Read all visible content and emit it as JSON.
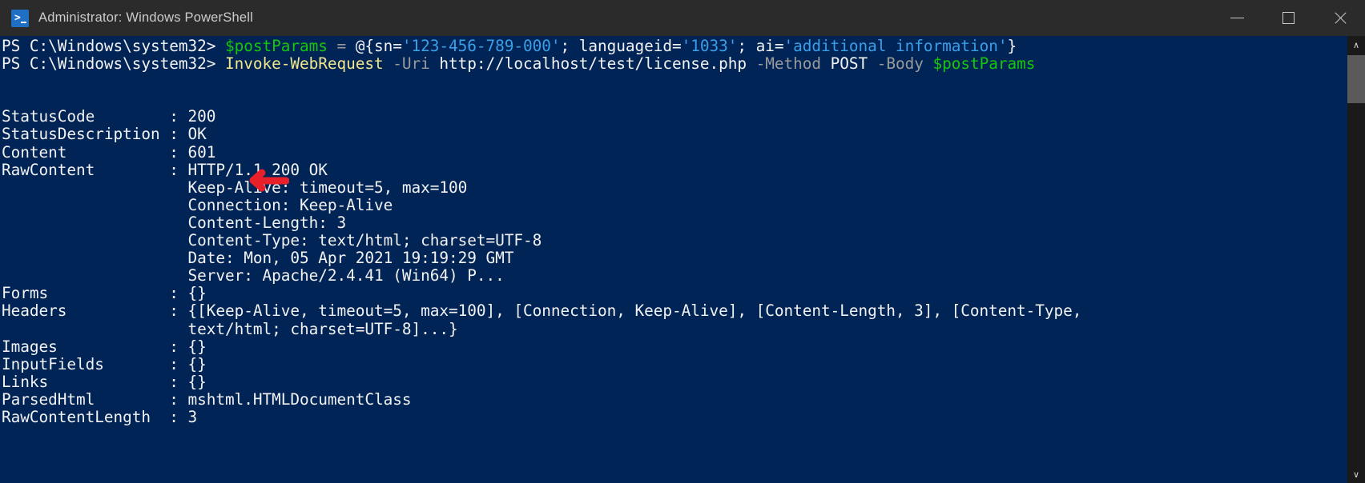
{
  "window": {
    "title": "Administrator: Windows PowerShell",
    "app_icon": "powershell-prompt-icon",
    "controls": {
      "minimize_label": "Minimize",
      "maximize_label": "Maximize",
      "close_label": "Close"
    }
  },
  "colors": {
    "titlebar_bg": "#2b2b2b",
    "console_bg": "#012456",
    "text": "#f2f2f2",
    "variable_green": "#16c60c",
    "string_cyan": "#3b9fe8",
    "parameter_gray": "#9a9a9a",
    "command_yellow": "#f0e68c",
    "annotation_red": "#e8202a",
    "scrollbar_track": "#1a1a1a",
    "scrollbar_thumb": "#5a5a5a"
  },
  "console": {
    "prompt": "PS C:\\Windows\\system32>",
    "command_1": {
      "variable": "$postParams",
      "equals": " = ",
      "hash_open": "@{sn=",
      "sn_value": "'123-456-789-000'",
      "sep_1": "; languageid=",
      "languageid_value": "'1033'",
      "sep_2": "; ai=",
      "ai_value": "'additional information'",
      "hash_close": "}"
    },
    "command_2": {
      "cmdlet": "Invoke-WebRequest",
      "param_uri": "-Uri",
      "uri_value": "http://localhost/test/license.php",
      "param_method": "-Method",
      "method_value": "POST",
      "param_body": "-Body",
      "body_value": "$postParams"
    },
    "output": {
      "rows": [
        {
          "key": "StatusCode",
          "sep": ":",
          "value": "200"
        },
        {
          "key": "StatusDescription",
          "sep": ":",
          "value": "OK"
        },
        {
          "key": "Content",
          "sep": ":",
          "value": "601"
        },
        {
          "key": "RawContent",
          "sep": ":",
          "value": "HTTP/1.1 200 OK"
        }
      ],
      "rawcontent_continuation": [
        "Keep-Alive: timeout=5, max=100",
        "Connection: Keep-Alive",
        "Content-Length: 3",
        "Content-Type: text/html; charset=UTF-8",
        "Date: Mon, 05 Apr 2021 19:19:29 GMT",
        "Server: Apache/2.4.41 (Win64) P..."
      ],
      "rows_2": [
        {
          "key": "Forms",
          "sep": ":",
          "value": "{}"
        },
        {
          "key": "Headers",
          "sep": ":",
          "value": "{[Keep-Alive, timeout=5, max=100], [Connection, Keep-Alive], [Content-Length, 3], [Content-Type,"
        }
      ],
      "headers_continuation": "text/html; charset=UTF-8]...}",
      "rows_3": [
        {
          "key": "Images",
          "sep": ":",
          "value": "{}"
        },
        {
          "key": "InputFields",
          "sep": ":",
          "value": "{}"
        },
        {
          "key": "Links",
          "sep": ":",
          "value": "{}"
        },
        {
          "key": "ParsedHtml",
          "sep": ":",
          "value": "mshtml.HTMLDocumentClass"
        },
        {
          "key": "RawContentLength",
          "sep": ":",
          "value": "3"
        }
      ]
    }
  },
  "annotation": {
    "type": "arrow",
    "direction": "left",
    "points_at": "601",
    "color": "#e8202a"
  },
  "scrollbar": {
    "up_arrow": "∧",
    "down_arrow": "∨"
  }
}
